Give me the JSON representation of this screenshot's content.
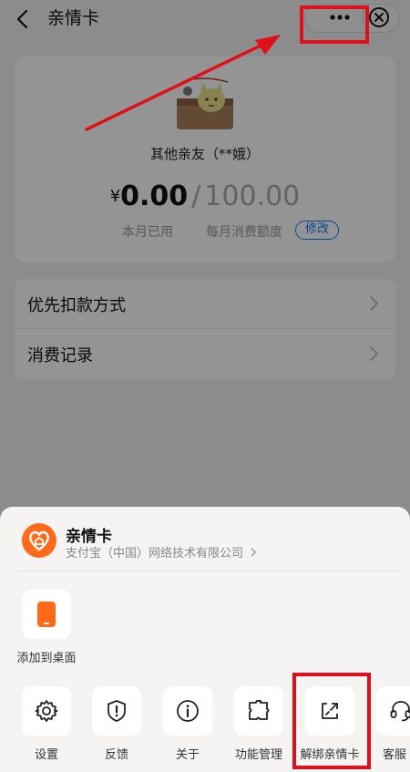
{
  "nav": {
    "title": "亲情卡",
    "icons": {
      "back": "chevron-left-icon",
      "more": "more-dots-icon",
      "close": "close-circle-icon"
    }
  },
  "card": {
    "relation": "其他亲友（**娥）",
    "currency": "¥",
    "used_amount": "0.00",
    "separator": "/",
    "quota_amount": "100.00",
    "used_label": "本月已用",
    "quota_label": "每月消费额度",
    "edit_label": "修改",
    "accent_color": "#1677ff"
  },
  "list": {
    "items": [
      {
        "label": "优先扣款方式"
      },
      {
        "label": "消费记录"
      }
    ]
  },
  "sheet": {
    "app_name": "亲情卡",
    "company": "支付宝（中国）网络技术有限公司",
    "brand_color": "#ff6a1a",
    "add_to_desktop": {
      "label": "添加到桌面",
      "icon": "phone-desktop-icon"
    },
    "actions": [
      {
        "label": "设置",
        "icon": "gear-icon"
      },
      {
        "label": "反馈",
        "icon": "feedback-shield-icon"
      },
      {
        "label": "关于",
        "icon": "info-icon"
      },
      {
        "label": "功能管理",
        "icon": "puzzle-icon"
      },
      {
        "label": "解绑亲情卡",
        "icon": "unbind-icon"
      },
      {
        "label": "客服",
        "icon": "headset-icon"
      }
    ]
  },
  "annotation": {
    "color": "#e0101a"
  }
}
